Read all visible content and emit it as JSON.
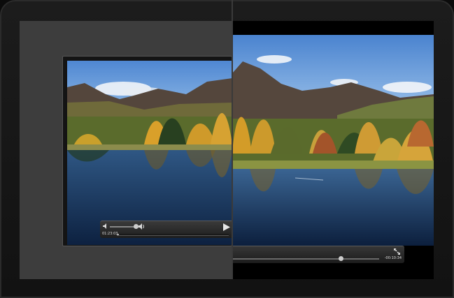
{
  "player_left": {
    "elapsed_time": "01:23:03",
    "progress": 0.02
  },
  "player_right": {
    "remaining_time": "-00:10:34",
    "progress": 0.74
  },
  "colors": {
    "sky": "#5b8fd6",
    "water": "#18385f",
    "mountain": "#5c4a3e",
    "foliage": "#d39c28",
    "control_bar": "#2a2a2a",
    "pane_gray": "#3d3d3d"
  }
}
